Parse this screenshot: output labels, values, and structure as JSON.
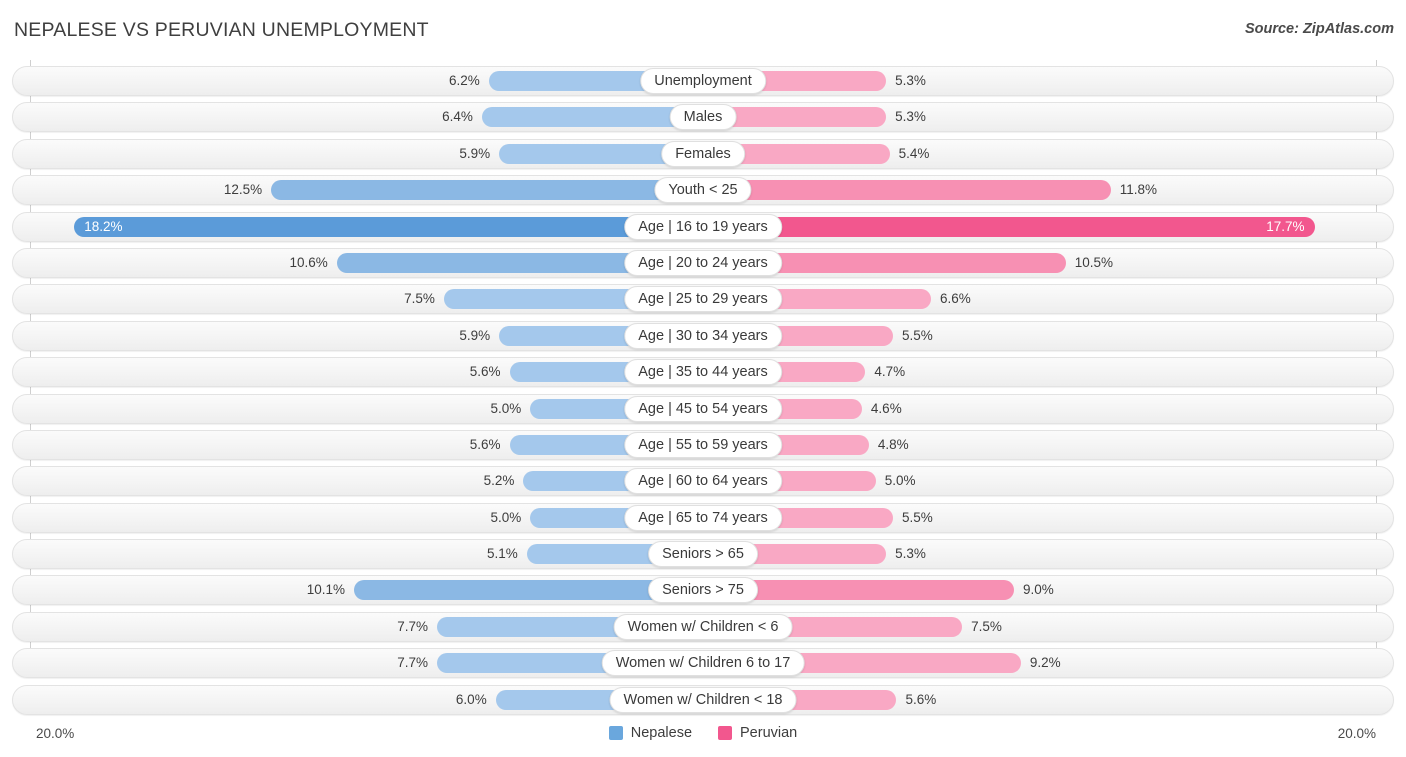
{
  "header": {
    "title": "NEPALESE VS PERUVIAN UNEMPLOYMENT",
    "source": "Source: ZipAtlas.com"
  },
  "axis": {
    "left_max_label": "20.0%",
    "right_max_label": "20.0%",
    "max_value": 20.0
  },
  "legend": {
    "items": [
      {
        "label": "Nepalese",
        "color": "#6aa7dd"
      },
      {
        "label": "Peruvian",
        "color": "#f2578e"
      }
    ]
  },
  "colors": {
    "left_light": "#a4c8ec",
    "left_mid": "#8bb8e4",
    "left_dark": "#5b9bd9",
    "right_light": "#f9a8c4",
    "right_mid": "#f790b3",
    "right_dark": "#f2578e",
    "track": "#f4f4f4"
  },
  "chart_data": {
    "type": "bar",
    "subtype": "diverging-tornado",
    "title": "NEPALESE VS PERUVIAN UNEMPLOYMENT",
    "xlabel": "",
    "ylabel": "",
    "xlim": [
      20.0,
      20.0
    ],
    "grid": false,
    "legend_position": "bottom-center",
    "categories": [
      "Unemployment",
      "Males",
      "Females",
      "Youth < 25",
      "Age | 16 to 19 years",
      "Age | 20 to 24 years",
      "Age | 25 to 29 years",
      "Age | 30 to 34 years",
      "Age | 35 to 44 years",
      "Age | 45 to 54 years",
      "Age | 55 to 59 years",
      "Age | 60 to 64 years",
      "Age | 65 to 74 years",
      "Seniors > 65",
      "Seniors > 75",
      "Women w/ Children < 6",
      "Women w/ Children 6 to 17",
      "Women w/ Children < 18"
    ],
    "series": [
      {
        "name": "Nepalese",
        "side": "left",
        "values": [
          6.2,
          6.4,
          5.9,
          12.5,
          18.2,
          10.6,
          7.5,
          5.9,
          5.6,
          5.0,
          5.6,
          5.2,
          5.0,
          5.1,
          10.1,
          7.7,
          7.7,
          6.0
        ],
        "labels": [
          "6.2%",
          "6.4%",
          "5.9%",
          "12.5%",
          "18.2%",
          "10.6%",
          "7.5%",
          "5.9%",
          "5.6%",
          "5.0%",
          "5.6%",
          "5.2%",
          "5.0%",
          "5.1%",
          "10.1%",
          "7.7%",
          "7.7%",
          "6.0%"
        ]
      },
      {
        "name": "Peruvian",
        "side": "right",
        "values": [
          5.3,
          5.3,
          5.4,
          11.8,
          17.7,
          10.5,
          6.6,
          5.5,
          4.7,
          4.6,
          4.8,
          5.0,
          5.5,
          5.3,
          9.0,
          7.5,
          9.2,
          5.6
        ],
        "labels": [
          "5.3%",
          "5.3%",
          "5.4%",
          "11.8%",
          "17.7%",
          "10.5%",
          "6.6%",
          "5.5%",
          "4.7%",
          "4.6%",
          "4.8%",
          "5.0%",
          "5.5%",
          "5.3%",
          "9.0%",
          "7.5%",
          "9.2%",
          "5.6%"
        ]
      }
    ]
  },
  "rows": [
    {
      "label": "Unemployment",
      "left": "6.2%",
      "right": "5.3%",
      "lv": 6.2,
      "rv": 5.3,
      "tone": 0
    },
    {
      "label": "Males",
      "left": "6.4%",
      "right": "5.3%",
      "lv": 6.4,
      "rv": 5.3,
      "tone": 0
    },
    {
      "label": "Females",
      "left": "5.9%",
      "right": "5.4%",
      "lv": 5.9,
      "rv": 5.4,
      "tone": 0
    },
    {
      "label": "Youth < 25",
      "left": "12.5%",
      "right": "11.8%",
      "lv": 12.5,
      "rv": 11.8,
      "tone": 1
    },
    {
      "label": "Age | 16 to 19 years",
      "left": "18.2%",
      "right": "17.7%",
      "lv": 18.2,
      "rv": 17.7,
      "tone": 2
    },
    {
      "label": "Age | 20 to 24 years",
      "left": "10.6%",
      "right": "10.5%",
      "lv": 10.6,
      "rv": 10.5,
      "tone": 1
    },
    {
      "label": "Age | 25 to 29 years",
      "left": "7.5%",
      "right": "6.6%",
      "lv": 7.5,
      "rv": 6.6,
      "tone": 0
    },
    {
      "label": "Age | 30 to 34 years",
      "left": "5.9%",
      "right": "5.5%",
      "lv": 5.9,
      "rv": 5.5,
      "tone": 0
    },
    {
      "label": "Age | 35 to 44 years",
      "left": "5.6%",
      "right": "4.7%",
      "lv": 5.6,
      "rv": 4.7,
      "tone": 0
    },
    {
      "label": "Age | 45 to 54 years",
      "left": "5.0%",
      "right": "4.6%",
      "lv": 5.0,
      "rv": 4.6,
      "tone": 0
    },
    {
      "label": "Age | 55 to 59 years",
      "left": "5.6%",
      "right": "4.8%",
      "lv": 5.6,
      "rv": 4.8,
      "tone": 0
    },
    {
      "label": "Age | 60 to 64 years",
      "left": "5.2%",
      "right": "5.0%",
      "lv": 5.2,
      "rv": 5.0,
      "tone": 0
    },
    {
      "label": "Age | 65 to 74 years",
      "left": "5.0%",
      "right": "5.5%",
      "lv": 5.0,
      "rv": 5.5,
      "tone": 0
    },
    {
      "label": "Seniors > 65",
      "left": "5.1%",
      "right": "5.3%",
      "lv": 5.1,
      "rv": 5.3,
      "tone": 0
    },
    {
      "label": "Seniors > 75",
      "left": "10.1%",
      "right": "9.0%",
      "lv": 10.1,
      "rv": 9.0,
      "tone": 1
    },
    {
      "label": "Women w/ Children < 6",
      "left": "7.7%",
      "right": "7.5%",
      "lv": 7.7,
      "rv": 7.5,
      "tone": 0
    },
    {
      "label": "Women w/ Children 6 to 17",
      "left": "7.7%",
      "right": "9.2%",
      "lv": 7.7,
      "rv": 9.2,
      "tone": 0
    },
    {
      "label": "Women w/ Children < 18",
      "left": "6.0%",
      "right": "5.6%",
      "lv": 6.0,
      "rv": 5.6,
      "tone": 0
    }
  ]
}
